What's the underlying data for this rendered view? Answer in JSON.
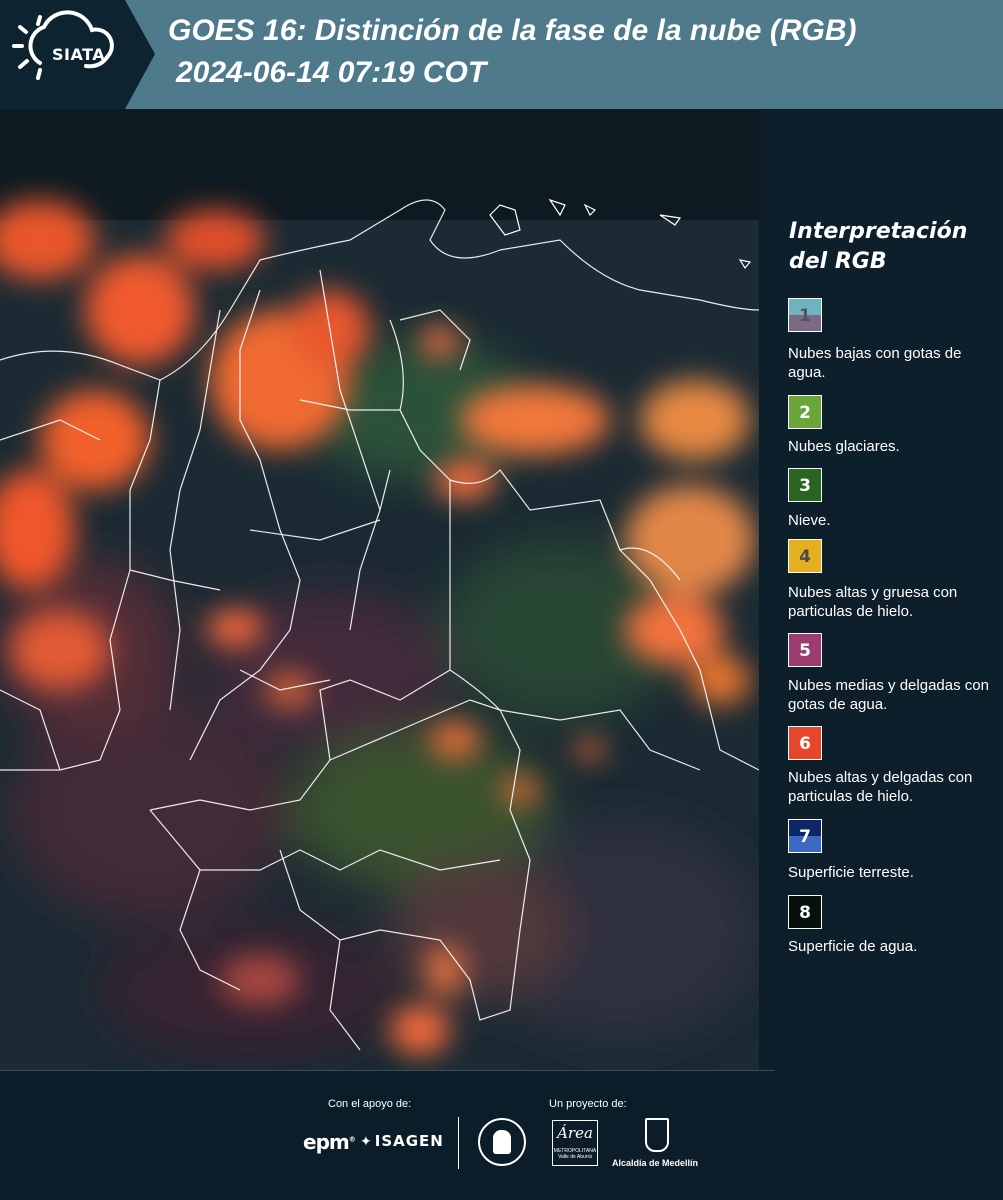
{
  "header": {
    "logo_text": "SIATA",
    "title_line1": "GOES 16: Distinción de la fase de la nube (RGB)",
    "title_line2": "2024-06-14 07:19 COT"
  },
  "legend": {
    "title": "Interpretación del RGB",
    "items": [
      {
        "number": "1",
        "label": "Nubes bajas con gotas de agua.",
        "color": "#6fb3c3",
        "color2": "#7a6a86"
      },
      {
        "number": "2",
        "label": "Nubes glaciares.",
        "color": "#6aa539"
      },
      {
        "number": "3",
        "label": "Nieve.",
        "color": "#2b6322"
      },
      {
        "number": "4",
        "label": "Nubes altas y gruesa con particulas de hielo.",
        "color": "#e5b020"
      },
      {
        "number": "5",
        "label": "Nubes medias y delgadas con gotas de agua.",
        "color": "#9c3d71"
      },
      {
        "number": "6",
        "label": "Nubes altas y delgadas con particulas de hielo.",
        "color": "#e6472b"
      },
      {
        "number": "7",
        "label": "Superficie terreste.",
        "color": "#0c2669",
        "color2": "#3c68c2"
      },
      {
        "number": "8",
        "label": "Superficie de agua.",
        "color": "#07110c"
      }
    ]
  },
  "footer": {
    "support_caption": "Con el apoyo de:",
    "project_caption": "Un proyecto de:",
    "epm": "epm",
    "isagen": "ISAGEN",
    "area_logo": "Área",
    "area_sub": "METROPOLITANA Valle de Aburrá",
    "alcaldia": "Alcaldía de Medellín"
  }
}
